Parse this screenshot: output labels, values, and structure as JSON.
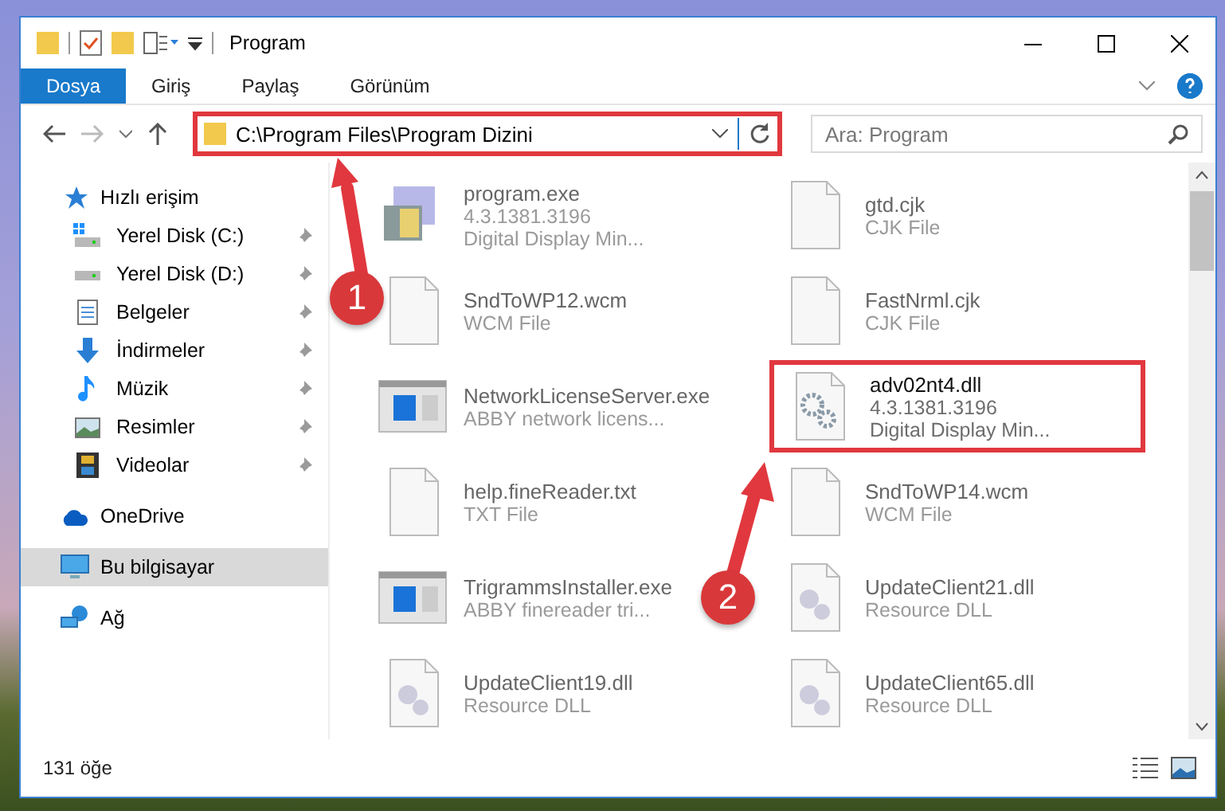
{
  "window": {
    "title": "Program"
  },
  "ribbon_tabs": [
    {
      "label": "Dosya",
      "selected": true
    },
    {
      "label": "Giriş",
      "selected": false
    },
    {
      "label": "Paylaş",
      "selected": false
    },
    {
      "label": "Görünüm",
      "selected": false
    }
  ],
  "address": {
    "path": "C:\\Program Files\\Program Dizini",
    "highlighted": true
  },
  "search": {
    "placeholder": "Ara: Program"
  },
  "sidebar": {
    "items": [
      {
        "label": "Hızlı erişim",
        "kind": "star",
        "selected": false,
        "children": [
          {
            "label": "Yerel Disk (C:)",
            "kind": "drive-c",
            "pinned": true
          },
          {
            "label": "Yerel Disk (D:)",
            "kind": "drive",
            "pinned": true
          },
          {
            "label": "Belgeler",
            "kind": "document",
            "pinned": true
          },
          {
            "label": "İndirmeler",
            "kind": "download",
            "pinned": true
          },
          {
            "label": "Müzik",
            "kind": "music",
            "pinned": true
          },
          {
            "label": "Resimler",
            "kind": "picture",
            "pinned": true
          },
          {
            "label": "Videolar",
            "kind": "video",
            "pinned": true
          }
        ]
      },
      {
        "label": "OneDrive",
        "kind": "cloud",
        "selected": false
      },
      {
        "label": "Bu bilgisayar",
        "kind": "computer",
        "selected": true
      },
      {
        "label": "Ağ",
        "kind": "network",
        "selected": false
      }
    ]
  },
  "files": [
    {
      "name": "program.exe",
      "details": [
        "4.3.1381.3196",
        "Digital Display Min..."
      ],
      "kind": "installer",
      "blurred": true,
      "highlighted": false
    },
    {
      "name": "gtd.cjk",
      "details": [
        "CJK File"
      ],
      "kind": "blank",
      "blurred": true,
      "highlighted": false
    },
    {
      "name": "SndToWP12.wcm",
      "details": [
        "WCM File"
      ],
      "kind": "blank",
      "blurred": true,
      "highlighted": false
    },
    {
      "name": "FastNrml.cjk",
      "details": [
        "CJK File"
      ],
      "kind": "blank",
      "blurred": true,
      "highlighted": false
    },
    {
      "name": "NetworkLicenseServer.exe",
      "details": [
        "ABBY network licens..."
      ],
      "kind": "app",
      "blurred": true,
      "highlighted": false
    },
    {
      "name": "adv02nt4.dll",
      "details": [
        "4.3.1381.3196",
        "Digital Display Min..."
      ],
      "kind": "gear",
      "blurred": false,
      "highlighted": true
    },
    {
      "name": "help.fineReader.txt",
      "details": [
        "TXT File"
      ],
      "kind": "blank",
      "blurred": true,
      "highlighted": false
    },
    {
      "name": "SndToWP14.wcm",
      "details": [
        "WCM File"
      ],
      "kind": "blank",
      "blurred": true,
      "highlighted": false
    },
    {
      "name": "TrigrammsInstaller.exe",
      "details": [
        "ABBY finereader tri..."
      ],
      "kind": "app",
      "blurred": true,
      "highlighted": false
    },
    {
      "name": "UpdateClient21.dll",
      "details": [
        "Resource DLL"
      ],
      "kind": "dll",
      "blurred": true,
      "highlighted": false
    },
    {
      "name": "UpdateClient19.dll",
      "details": [
        "Resource DLL"
      ],
      "kind": "dll",
      "blurred": true,
      "highlighted": false
    },
    {
      "name": "UpdateClient65.dll",
      "details": [
        "Resource DLL"
      ],
      "kind": "dll",
      "blurred": true,
      "highlighted": false
    }
  ],
  "status_bar": {
    "count": "131 öğe"
  },
  "annotations": [
    {
      "number": "1"
    },
    {
      "number": "2"
    }
  ]
}
